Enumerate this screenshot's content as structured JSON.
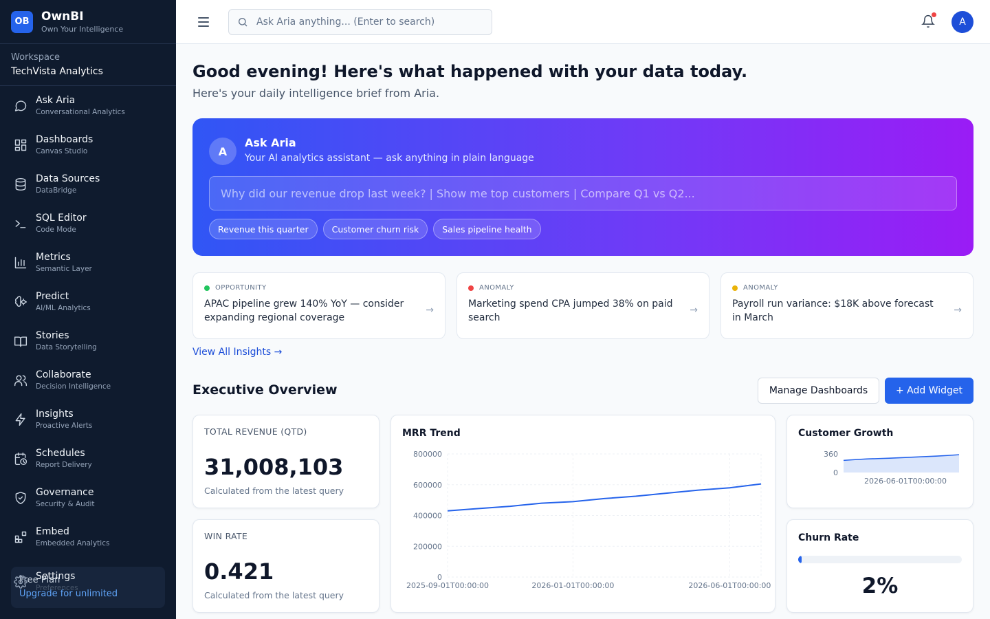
{
  "brand": {
    "logo": "OB",
    "name": "OwnBI",
    "tagline": "Own Your Intelligence"
  },
  "workspace": {
    "label": "Workspace",
    "name": "TechVista Analytics"
  },
  "nav": [
    {
      "title": "Ask Aria",
      "sub": "Conversational Analytics",
      "icon": "chat-icon"
    },
    {
      "title": "Dashboards",
      "sub": "Canvas Studio",
      "icon": "grid-icon"
    },
    {
      "title": "Data Sources",
      "sub": "DataBridge",
      "icon": "database-icon"
    },
    {
      "title": "SQL Editor",
      "sub": "Code Mode",
      "icon": "terminal-icon"
    },
    {
      "title": "Metrics",
      "sub": "Semantic Layer",
      "icon": "bar-chart-icon"
    },
    {
      "title": "Predict",
      "sub": "AI/ML Analytics",
      "icon": "brain-icon"
    },
    {
      "title": "Stories",
      "sub": "Data Storytelling",
      "icon": "book-icon"
    },
    {
      "title": "Collaborate",
      "sub": "Decision Intelligence",
      "icon": "users-icon"
    },
    {
      "title": "Insights",
      "sub": "Proactive Alerts",
      "icon": "lightning-icon"
    },
    {
      "title": "Schedules",
      "sub": "Report Delivery",
      "icon": "calendar-clock-icon"
    },
    {
      "title": "Governance",
      "sub": "Security & Audit",
      "icon": "shield-icon"
    },
    {
      "title": "Embed",
      "sub": "Embedded Analytics",
      "icon": "embed-blocks-icon"
    }
  ],
  "settings": {
    "title": "Settings",
    "sub": "Preferences",
    "icon": "gear-icon"
  },
  "plan": {
    "name": "Free Plan",
    "upgrade": "Upgrade for unlimited"
  },
  "topbar": {
    "search_placeholder": "Ask Aria anything... (Enter to search)",
    "avatar": "A"
  },
  "greeting": {
    "title": "Good evening! Here's what happened with your data today.",
    "subtitle": "Here's your daily intelligence brief from Aria."
  },
  "aria": {
    "avatar": "A",
    "title": "Ask Aria",
    "subtitle": "Your AI analytics assistant — ask anything in plain language",
    "placeholder": "Why did our revenue drop last week? | Show me top customers | Compare Q1 vs Q2...",
    "chips": [
      "Revenue this quarter",
      "Customer churn risk",
      "Sales pipeline health"
    ],
    "gradient": [
      "#3056f5",
      "#9a1cf5"
    ]
  },
  "insights": [
    {
      "tag": "OPPORTUNITY",
      "color": "#22c55e",
      "text": "APAC pipeline grew 140% YoY — consider expanding regional coverage",
      "arrow": "→"
    },
    {
      "tag": "ANOMALY",
      "color": "#ef4444",
      "text": "Marketing spend CPA jumped 38% on paid search",
      "arrow": "→"
    },
    {
      "tag": "ANOMALY",
      "color": "#eab308",
      "text": "Payroll run variance: $18K above forecast in March",
      "arrow": "→"
    }
  ],
  "view_all": "View All Insights →",
  "overview": {
    "title": "Executive Overview",
    "manage": "Manage Dashboards",
    "add": "+ Add Widget"
  },
  "kpis": [
    {
      "label": "TOTAL REVENUE (QTD)",
      "value": "31,008,103",
      "note": "Calculated from the latest query"
    },
    {
      "label": "WIN RATE",
      "value": "0.421",
      "note": "Calculated from the latest query"
    }
  ],
  "churn": {
    "title": "Churn Rate",
    "value": "2%",
    "fraction": 0.02
  },
  "chart_data": [
    {
      "type": "line",
      "title": "MRR Trend",
      "x": [
        "2025-09-01T00:00:00",
        "2025-10-01T00:00:00",
        "2025-11-01T00:00:00",
        "2025-12-01T00:00:00",
        "2026-01-01T00:00:00",
        "2026-02-01T00:00:00",
        "2026-03-01T00:00:00",
        "2026-04-01T00:00:00",
        "2026-05-01T00:00:00",
        "2026-06-01T00:00:00",
        "2026-07-01T00:00:00"
      ],
      "xticks": [
        "2025-09-01T00:00:00",
        "2026-01-01T00:00:00",
        "2026-06-01T00:00:00"
      ],
      "y": [
        430000,
        445000,
        460000,
        480000,
        490000,
        510000,
        525000,
        545000,
        565000,
        580000,
        605000
      ],
      "ylim": [
        0,
        800000
      ],
      "yticks": [
        0,
        200000,
        400000,
        600000,
        800000
      ],
      "grid": true,
      "color": "#2563eb"
    },
    {
      "type": "area",
      "title": "Customer Growth",
      "x": [
        "2025-09-01T00:00:00",
        "2025-10-01T00:00:00",
        "2025-11-01T00:00:00",
        "2025-12-01T00:00:00",
        "2026-01-01T00:00:00",
        "2026-02-01T00:00:00",
        "2026-03-01T00:00:00",
        "2026-04-01T00:00:00",
        "2026-05-01T00:00:00",
        "2026-06-01T00:00:00",
        "2026-07-01T00:00:00"
      ],
      "xticks": [
        "2026-06-01T00:00:00"
      ],
      "y": [
        235,
        250,
        262,
        270,
        278,
        288,
        298,
        308,
        318,
        330,
        345
      ],
      "ylim": [
        0,
        360
      ],
      "yticks": [
        0,
        360
      ],
      "color": "#2563eb",
      "fill": "#dbe6fb"
    }
  ]
}
